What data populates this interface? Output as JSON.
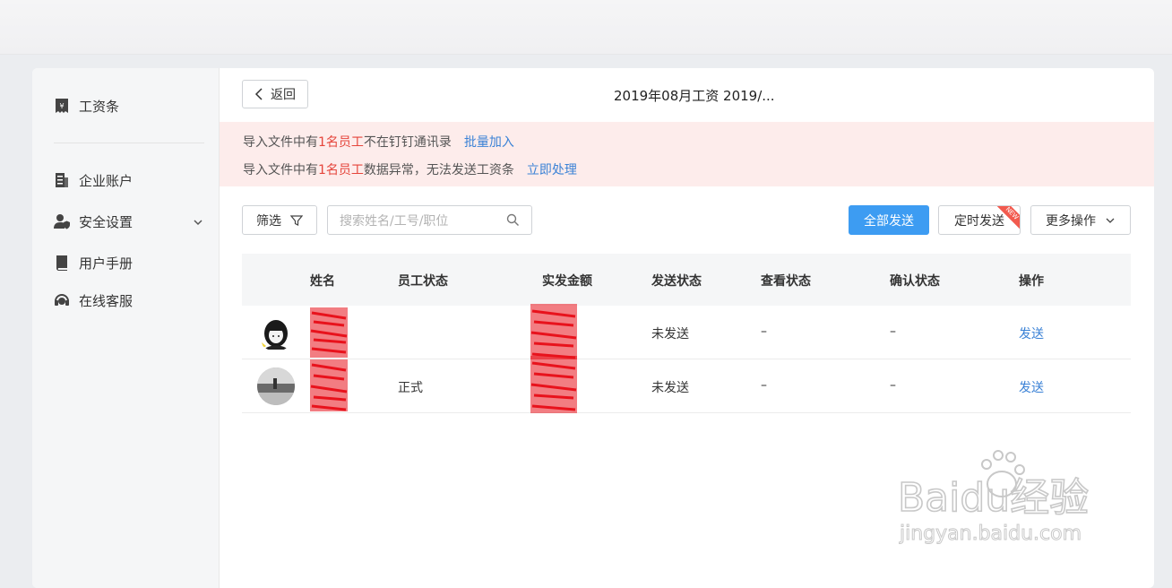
{
  "sidebar": {
    "items": [
      {
        "label": "工资条",
        "icon": "payslip-icon"
      },
      {
        "label": "企业账户",
        "icon": "document-icon"
      },
      {
        "label": "安全设置",
        "icon": "user-shield-icon"
      },
      {
        "label": "用户手册",
        "icon": "book-icon"
      },
      {
        "label": "在线客服",
        "icon": "headset-icon"
      }
    ]
  },
  "header": {
    "back_label": "返回",
    "title": "2019年08月工资 2019/..."
  },
  "alerts": [
    {
      "prefix": "导入文件中有",
      "highlight": "1名员工",
      "suffix": "不在钉钉通讯录",
      "action": "批量加入"
    },
    {
      "prefix": "导入文件中有",
      "highlight": "1名员工",
      "suffix": "数据异常，无法发送工资条",
      "action": "立即处理"
    }
  ],
  "toolbar": {
    "filter_label": "筛选",
    "search_placeholder": "搜索姓名/工号/职位",
    "send_all_label": "全部发送",
    "timed_send_label": "定时发送",
    "timed_badge": "NEW",
    "more_label": "更多操作"
  },
  "table": {
    "columns": [
      "姓名",
      "员工状态",
      "实发金额",
      "发送状态",
      "查看状态",
      "确认状态",
      "操作"
    ],
    "rows": [
      {
        "status": "",
        "send_status": "未发送",
        "view_status": "–",
        "confirm_status": "–",
        "action": "发送"
      },
      {
        "status": "正式",
        "send_status": "未发送",
        "view_status": "–",
        "confirm_status": "–",
        "action": "发送"
      }
    ]
  },
  "watermark": {
    "brand": "Baidu经验",
    "url": "jingyan.baidu.com"
  },
  "colors": {
    "primary": "#3d9cf2",
    "alert_bg": "#fdeceb",
    "highlight": "#e5453b",
    "link": "#3b82d6"
  }
}
